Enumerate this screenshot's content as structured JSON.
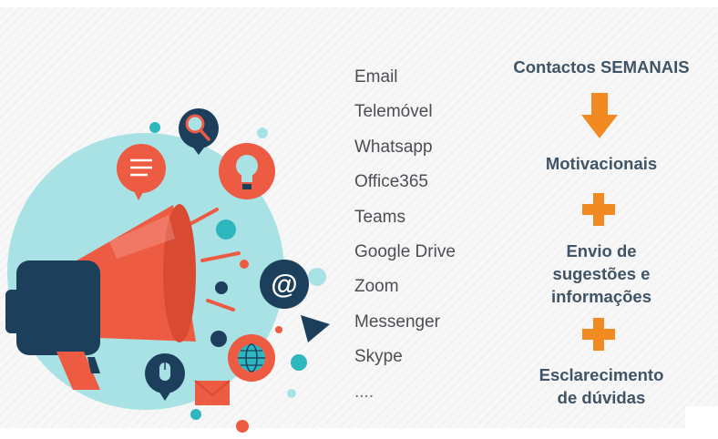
{
  "channels": [
    "Email",
    "Telemóvel",
    "Whatsapp",
    "Office365",
    "Teams",
    "Google Drive",
    "Zoom",
    "Messenger",
    "Skype",
    "...."
  ],
  "flow": {
    "weekly_contacts": "Contactos SEMANAIS",
    "motivational": "Motivacionais",
    "suggestions_line1": "Envio de",
    "suggestions_line2": "sugestões e",
    "suggestions_line3": "informações",
    "clarification_line1": "Esclarecimento",
    "clarification_line2": "de dúvidas"
  },
  "icons": {
    "email_symbol": "@"
  },
  "colors": {
    "orange": "#f28a22",
    "coral": "#ee5b43",
    "navy": "#1c3f5b",
    "teal_light": "#a9e2e4",
    "teal": "#2fb7c0",
    "text_dark": "#3f5466",
    "text_list": "#4b4f54"
  }
}
